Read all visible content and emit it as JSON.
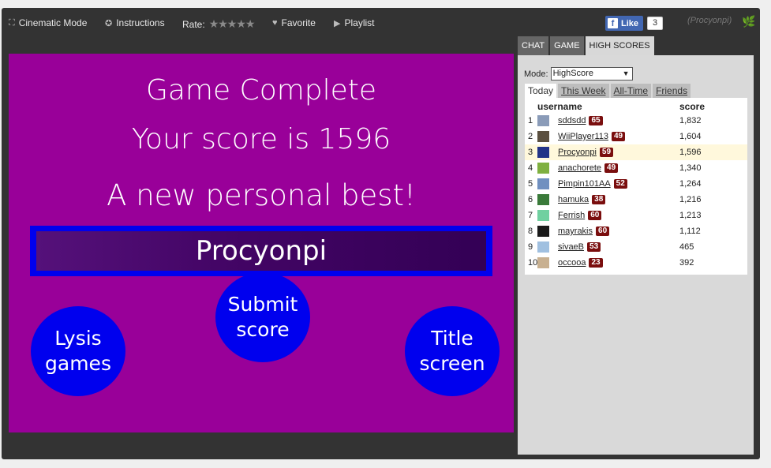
{
  "topbar": {
    "items": [
      {
        "label": "Cinematic Mode",
        "icon": "expand-icon"
      },
      {
        "label": "Instructions",
        "icon": "info-icon"
      },
      {
        "label": "Rate:",
        "icon": ""
      },
      {
        "label": "Favorite",
        "icon": "heart-icon"
      },
      {
        "label": "Playlist",
        "icon": "play-icon"
      }
    ],
    "rating_stars": "★★★★★",
    "like_label": "Like",
    "like_count": "3",
    "username": "(Procyonpi)"
  },
  "game": {
    "title": "Game Complete",
    "score_text": "Your score is 1596",
    "best_text": "A new personal best!",
    "player_name": "Procyonpi",
    "buttons": {
      "lysis": "Lysis games",
      "submit": "Submit score",
      "title": "Title screen"
    },
    "colors": {
      "background": "#990099",
      "button": "#0000ee"
    }
  },
  "sidebar": {
    "tabs": [
      "CHAT",
      "GAME",
      "HIGH SCORES"
    ],
    "active_tab": "HIGH SCORES",
    "mode_label": "Mode:",
    "mode_value": "HighScore",
    "periods": [
      "Today",
      "This Week",
      "All-Time",
      "Friends"
    ],
    "active_period": "Today",
    "columns": {
      "username": "username",
      "score": "score"
    },
    "rows": [
      {
        "rank": "1",
        "username": "sddsdd",
        "level": "65",
        "score": "1,832",
        "avatar_color": "#8a9bb8"
      },
      {
        "rank": "2",
        "username": "WiiPlayer113",
        "level": "49",
        "score": "1,604",
        "avatar_color": "#5b5040"
      },
      {
        "rank": "3",
        "username": "Procyonpi",
        "level": "59",
        "score": "1,596",
        "avatar_color": "#223388",
        "highlight": true
      },
      {
        "rank": "4",
        "username": "anachorete",
        "level": "49",
        "score": "1,340",
        "avatar_color": "#7fb040"
      },
      {
        "rank": "5",
        "username": "Pimpin101AA",
        "level": "52",
        "score": "1,264",
        "avatar_color": "#7090c0"
      },
      {
        "rank": "6",
        "username": "hamuka",
        "level": "38",
        "score": "1,216",
        "avatar_color": "#3a7a3a"
      },
      {
        "rank": "7",
        "username": "Ferrish",
        "level": "60",
        "score": "1,213",
        "avatar_color": "#70d0a0"
      },
      {
        "rank": "8",
        "username": "mayrakis",
        "level": "60",
        "score": "1,112",
        "avatar_color": "#1a1a1a"
      },
      {
        "rank": "9",
        "username": "sivaeB",
        "level": "53",
        "score": "465",
        "avatar_color": "#a0c0e0"
      },
      {
        "rank": "10",
        "username": "occooa",
        "level": "23",
        "score": "392",
        "avatar_color": "#c8b090"
      }
    ]
  }
}
